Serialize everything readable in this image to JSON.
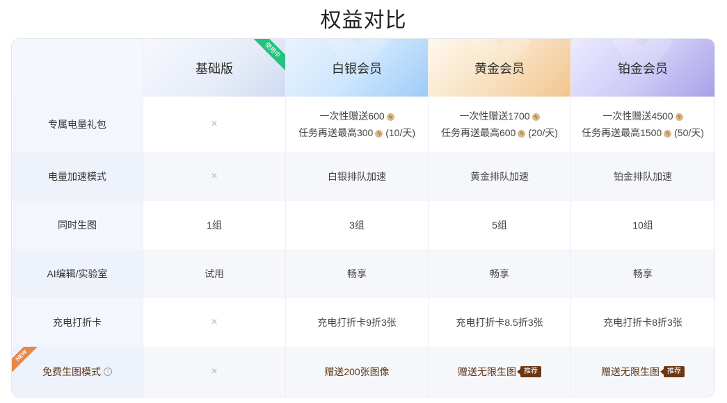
{
  "page": {
    "title": "权益对比"
  },
  "header": {
    "tiers": [
      "基础版",
      "白银会员",
      "黄金会员",
      "铂金会员"
    ],
    "current_badge": "使用中"
  },
  "rows": {
    "gift": {
      "label": "专属电量礼包",
      "basic": "×",
      "silver": {
        "line1": "一次性赠送600",
        "line2a": "任务再送最高300",
        "line2b": " (10/天)"
      },
      "gold": {
        "line1": "一次性赠送1700",
        "line2a": "任务再送最高600",
        "line2b": " (20/天)"
      },
      "platinum": {
        "line1": "一次性赠送4500",
        "line2a": "任务再送最高1500",
        "line2b": " (50/天)"
      }
    },
    "speed": {
      "label": "电量加速模式",
      "basic": "×",
      "silver": "白银排队加速",
      "gold": "黄金排队加速",
      "platinum": "铂金排队加速"
    },
    "concurrent": {
      "label": "同时生图",
      "basic": "1组",
      "silver": "3组",
      "gold": "5组",
      "platinum": "10组"
    },
    "ai_edit": {
      "label": "AI编辑/实验室",
      "basic": "试用",
      "silver": "畅享",
      "gold": "畅享",
      "platinum": "畅享"
    },
    "charge": {
      "label": "充电打折卡",
      "basic": "×",
      "silver": "充电打折卡9折3张",
      "gold": "充电打折卡8.5折3张",
      "platinum": "充电打折卡8折3张"
    },
    "free": {
      "new_tag": "NEW",
      "label": "免费生图模式",
      "basic": "×",
      "silver": "赠送200张图像",
      "gold": "赠送无限生图",
      "platinum": "赠送无限生图",
      "recommend_badge": "推荐"
    }
  },
  "icons": {
    "energy": "lightning-coin-icon",
    "info": "info-circle-icon",
    "cross": "cross-icon"
  },
  "colors": {
    "brown_text": "#5b3514",
    "recommend_bg": "#6b3611",
    "ribbon": "#23c37d",
    "new_tag": "#e5894a"
  }
}
